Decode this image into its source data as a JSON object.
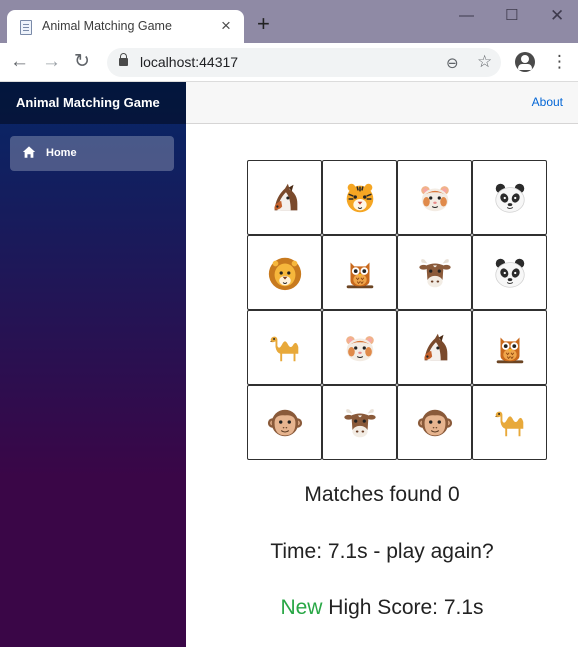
{
  "browser": {
    "tab_title": "Animal Matching Game",
    "tab_close": "×",
    "new_tab": "+",
    "window": {
      "minimize": "—",
      "maximize": "☐",
      "close": "✕"
    },
    "nav": {
      "back": "←",
      "forward": "→",
      "reload": "↻"
    },
    "url": "localhost:44317",
    "zoom_glyph": "⊖",
    "star_glyph": "☆",
    "menu_glyph": "⋮"
  },
  "app": {
    "brand": "Animal Matching Game",
    "nav_home": "Home",
    "about": "About"
  },
  "game": {
    "tiles": [
      "horse",
      "tiger",
      "hamster",
      "panda",
      "lion",
      "owl",
      "cow",
      "panda",
      "camel",
      "hamster",
      "horse",
      "owl",
      "monkey",
      "cow",
      "monkey",
      "camel"
    ],
    "matches_text": "Matches found 0",
    "time_text": "Time: 7.1s - play again?",
    "new_word": "New",
    "high_score_rest": " High Score: 7.1s"
  },
  "colors": {
    "sidebar_top": "#052767",
    "sidebar_bottom": "#3a0647",
    "link": "#0366d6",
    "new_highlight": "#28a745"
  }
}
